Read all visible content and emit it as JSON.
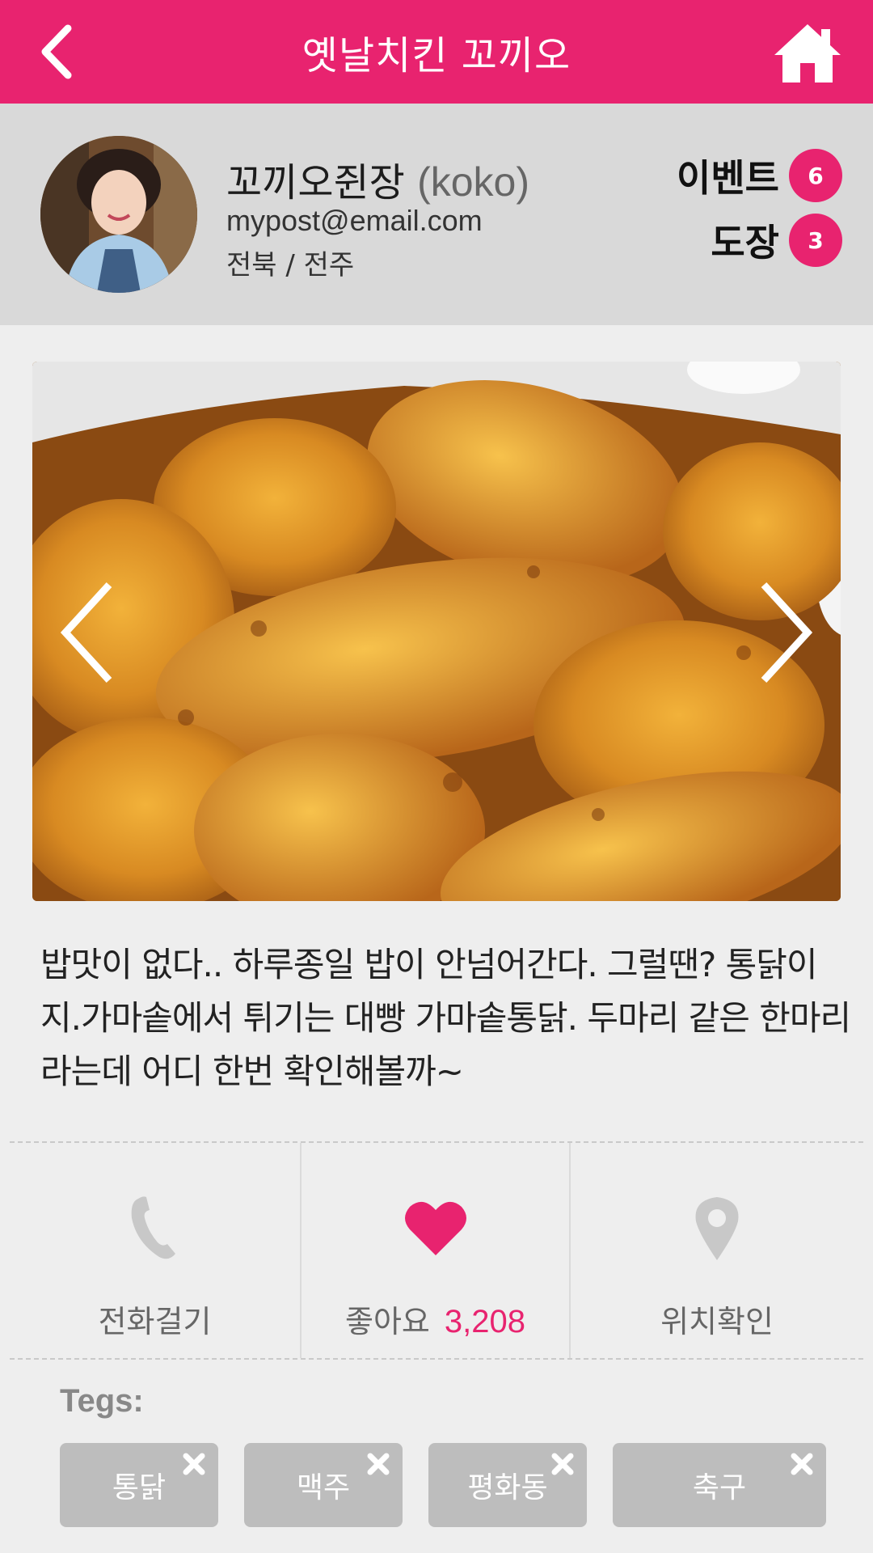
{
  "header": {
    "title": "옛날치킨 꼬끼오",
    "back_icon": "chevron-left-icon",
    "home_icon": "home-icon",
    "accent": "#e8236f"
  },
  "profile": {
    "name": "꼬끼오쥔장",
    "nickname": "(koko)",
    "email": "mypost@email.com",
    "region": "전북 / 전주",
    "stats": [
      {
        "label": "이벤트",
        "count": "6"
      },
      {
        "label": "도장",
        "count": "3"
      }
    ]
  },
  "post": {
    "description": "밥맛이 없다.. 하루종일 밥이 안넘어간다. 그럴땐? 통닭이지.가마솥에서 튀기는 대빵 가마솥통닭. 두마리 같은 한마리라는데 어디 한번 확인해볼까~"
  },
  "actions": {
    "call": {
      "label": "전화걸기",
      "icon": "phone-icon"
    },
    "like": {
      "label": "좋아요",
      "count": "3,208",
      "icon": "heart-icon"
    },
    "location": {
      "label": "위치확인",
      "icon": "map-pin-icon"
    }
  },
  "tags": {
    "label": "Tegs:",
    "items": [
      "통닭",
      "맥주",
      "평화동",
      "축구"
    ]
  }
}
